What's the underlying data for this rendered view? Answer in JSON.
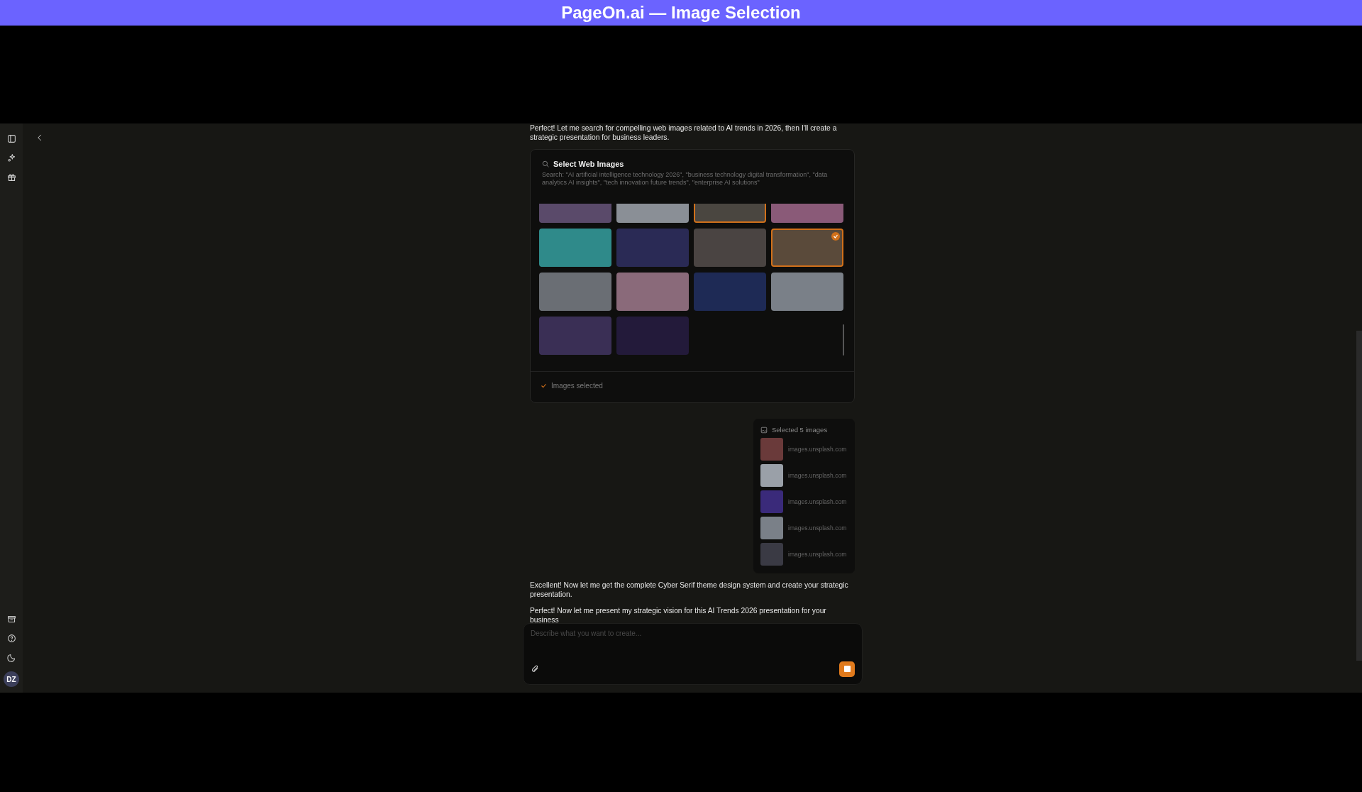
{
  "banner": {
    "title": "PageOn.ai — Image Selection"
  },
  "sidebar": {
    "avatar": "DZ"
  },
  "messages": [
    {
      "kind": "text",
      "text": "Perfect! Let me search for compelling web images related to AI trends in 2026, then I'll create a strategic presentation for business leaders."
    },
    {
      "kind": "image_search",
      "title": "Select Web Images",
      "query": "Search: \"AI artificial intelligence technology 2026\", \"business technology digital transformation\", \"data analytics AI insights\", \"tech innovation future trends\", \"enterprise AI solutions\"",
      "images": [
        {
          "selected": false
        },
        {
          "selected": false
        },
        {
          "selected": true
        },
        {
          "selected": false
        },
        {
          "selected": false
        },
        {
          "selected": false
        },
        {
          "selected": false
        },
        {
          "selected": true
        },
        {
          "selected": false
        },
        {
          "selected": false
        },
        {
          "selected": false
        },
        {
          "selected": false
        },
        {
          "selected": false
        },
        {
          "selected": false
        }
      ],
      "status": "Images selected"
    },
    {
      "kind": "selection",
      "title": "Selected 5 images",
      "items": [
        {
          "source": "images.unsplash.com"
        },
        {
          "source": "images.unsplash.com"
        },
        {
          "source": "images.unsplash.com"
        },
        {
          "source": "images.unsplash.com"
        },
        {
          "source": "images.unsplash.com"
        }
      ]
    },
    {
      "kind": "text",
      "text": "Excellent! Now let me get the complete Cyber Serif theme design system and create your strategic presentation."
    },
    {
      "kind": "text",
      "text": "Perfect! Now let me present my strategic vision for this AI Trends 2026 presentation for your business"
    }
  ],
  "composer": {
    "placeholder": "Describe what you want to create..."
  }
}
